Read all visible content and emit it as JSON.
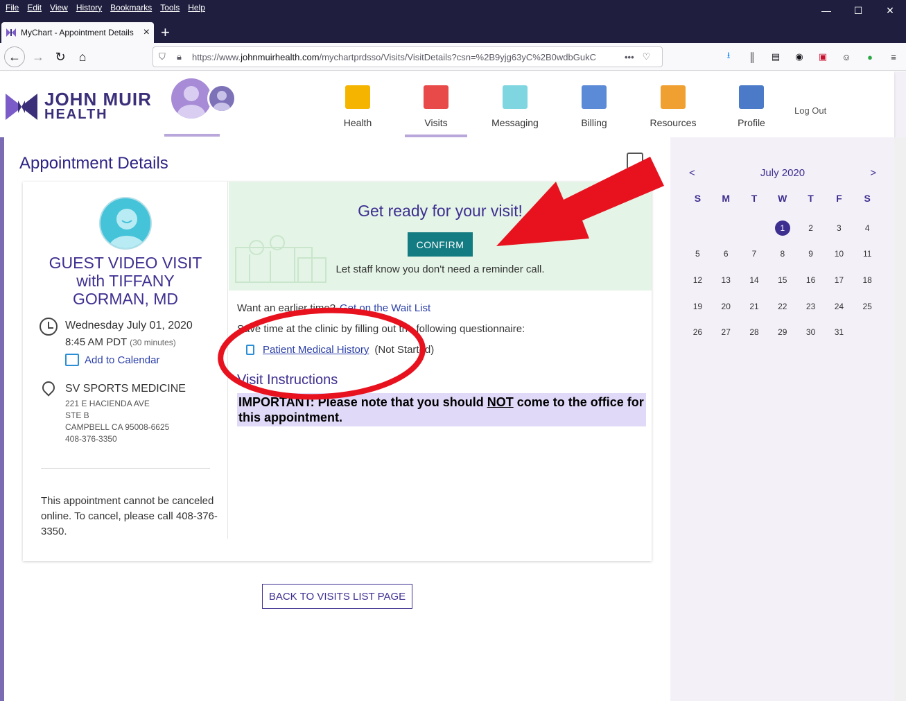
{
  "browser": {
    "menus": [
      "File",
      "Edit",
      "View",
      "History",
      "Bookmarks",
      "Tools",
      "Help"
    ],
    "tab_title": "MyChart - Appointment Details",
    "url_prefix": "https://www.",
    "url_domain": "johnmuirhealth.com",
    "url_path": "/mychartprdsso/Visits/VisitDetails?csn=%2B9yjg63yC%2B0wdbGukC",
    "window_controls": [
      "—",
      "☐",
      "✕"
    ]
  },
  "header": {
    "logo_line1": "JOHN MUIR",
    "logo_line2": "HEALTH",
    "nav": [
      {
        "label": "Health",
        "color": "#f5b400",
        "icon": "heart-folder-icon"
      },
      {
        "label": "Visits",
        "color": "#e84a4a",
        "icon": "calendar-icon"
      },
      {
        "label": "Messaging",
        "color": "#7fd6e0",
        "icon": "envelope-icon"
      },
      {
        "label": "Billing",
        "color": "#5b8ad6",
        "icon": "credit-card-icon"
      },
      {
        "label": "Resources",
        "color": "#f0a030",
        "icon": "book-icon"
      },
      {
        "label": "Profile",
        "color": "#4a7ac8",
        "icon": "id-card-icon"
      }
    ],
    "logout": "Log Out"
  },
  "main": {
    "title": "Appointment Details",
    "visit_name": "GUEST VIDEO VISIT with TIFFANY GORMAN, MD",
    "date": "Wednesday July 01, 2020",
    "time": "8:45 AM PDT",
    "duration": "(30 minutes)",
    "add_to_calendar": "Add to Calendar",
    "department": "SV SPORTS MEDICINE",
    "address_lines": [
      "221 E HACIENDA AVE",
      "STE B",
      "CAMPBELL CA 95008-6625",
      "408-376-3350"
    ],
    "cancel_note": "This appointment cannot be canceled online. To cancel, please call 408-376-3350.",
    "ready_title": "Get ready for your visit!",
    "confirm_label": "CONFIRM",
    "ready_sub": "Let staff know you don't need a reminder call.",
    "earlier_text": "Want an earlier time?",
    "waitlist_link": "Get on the Wait List",
    "save_time": "Save time at the clinic by filling out the following questionnaire:",
    "questionnaire": "Patient Medical History",
    "questionnaire_status": "(Not Started)",
    "instructions_title": "Visit Instructions",
    "instructions_pre": "IMPORTANT: Please note that you should ",
    "instructions_not": "NOT",
    "instructions_post": " come to the office for this appointment.",
    "back_button": "BACK TO VISITS LIST PAGE"
  },
  "calendar": {
    "prev": "<",
    "next": ">",
    "month": "July 2020",
    "dows": [
      "S",
      "M",
      "T",
      "W",
      "T",
      "F",
      "S"
    ],
    "first_weekday": 3,
    "days": [
      "1",
      "2",
      "3",
      "4",
      "5",
      "6",
      "7",
      "8",
      "9",
      "10",
      "11",
      "12",
      "13",
      "14",
      "15",
      "16",
      "17",
      "18",
      "19",
      "20",
      "21",
      "22",
      "23",
      "24",
      "25",
      "26",
      "27",
      "28",
      "29",
      "30",
      "31"
    ],
    "selected": "1"
  },
  "colors": {
    "brand": "#3d2f90",
    "confirm": "#137b82",
    "annotation": "#e8121f"
  }
}
